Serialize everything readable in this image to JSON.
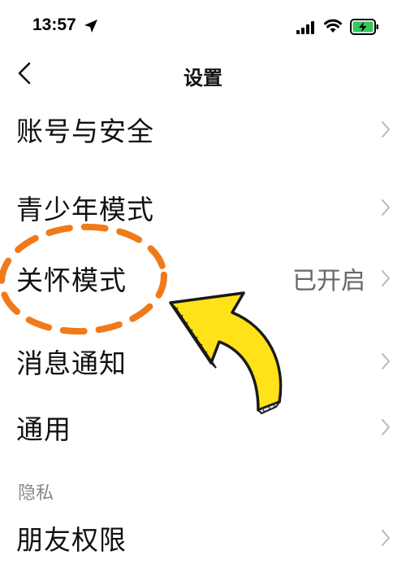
{
  "status_bar": {
    "time": "13:57",
    "icons": [
      "location-arrow-icon",
      "cellular-signal-icon",
      "wifi-icon",
      "battery-charging-icon"
    ]
  },
  "nav": {
    "title": "设置",
    "back_icon": "chevron-left-icon"
  },
  "settings": {
    "items": [
      {
        "label": "账号与安全",
        "value": ""
      },
      {
        "label": "青少年模式",
        "value": ""
      },
      {
        "label": "关怀模式",
        "value": "已开启"
      },
      {
        "label": "消息通知",
        "value": ""
      },
      {
        "label": "通用",
        "value": ""
      }
    ]
  },
  "privacy": {
    "header": "隐私",
    "items": [
      {
        "label": "朋友权限"
      }
    ]
  },
  "colors": {
    "background": "#ffffff",
    "text": "#111111",
    "value_text": "#666666",
    "chevron": "#b8b8b8",
    "annotation_circle": "#f07a1a",
    "annotation_arrow": "#ffe21a",
    "battery": "#34c759"
  }
}
